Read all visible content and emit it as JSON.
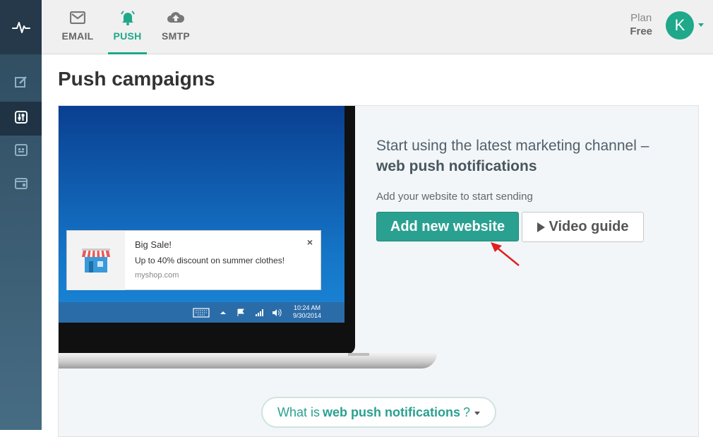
{
  "nav_tabs": [
    {
      "label": "EMAIL",
      "icon": "envelope-icon"
    },
    {
      "label": "PUSH",
      "icon": "bell-icon",
      "active": true
    },
    {
      "label": "SMTP",
      "icon": "cloud-upload-icon"
    }
  ],
  "plan": {
    "label": "Plan",
    "value": "Free"
  },
  "user": {
    "initial": "K"
  },
  "sidebar_icons": [
    "edit-icon",
    "sliders-icon",
    "calendar-icon",
    "browser-icon"
  ],
  "page_title": "Push campaigns",
  "promo": {
    "headline_plain": "Start using the latest marketing channel –",
    "headline_bold": "web push notifications",
    "subtext": "Add your website to start sending",
    "primary_button": "Add new website",
    "secondary_button": "Video guide"
  },
  "notification_preview": {
    "title": "Big Sale!",
    "body": "Up to 40% discount on summer clothes!",
    "url": "myshop.com",
    "close": "×",
    "time": "10:24 AM",
    "date": "9/30/2014"
  },
  "faq_pill": {
    "prefix": "What is",
    "bold": "web push notifications",
    "suffix": "?"
  },
  "colors": {
    "accent": "#1fa88a",
    "button": "#2aa190",
    "sidebar": "#2e4a5e",
    "arrow": "#e02020"
  }
}
